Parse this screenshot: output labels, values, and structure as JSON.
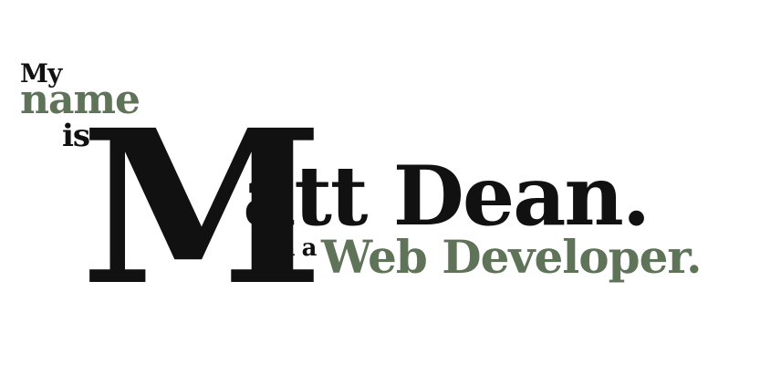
{
  "hero": {
    "my": "My",
    "name": "name",
    "is": "is",
    "first_letter": "M",
    "rest": "att Dean.",
    "im_a": "I'm a",
    "role": "Web Developer."
  },
  "colors": {
    "accent": "#5e7357",
    "text": "#111111",
    "background": "#ffffff"
  }
}
